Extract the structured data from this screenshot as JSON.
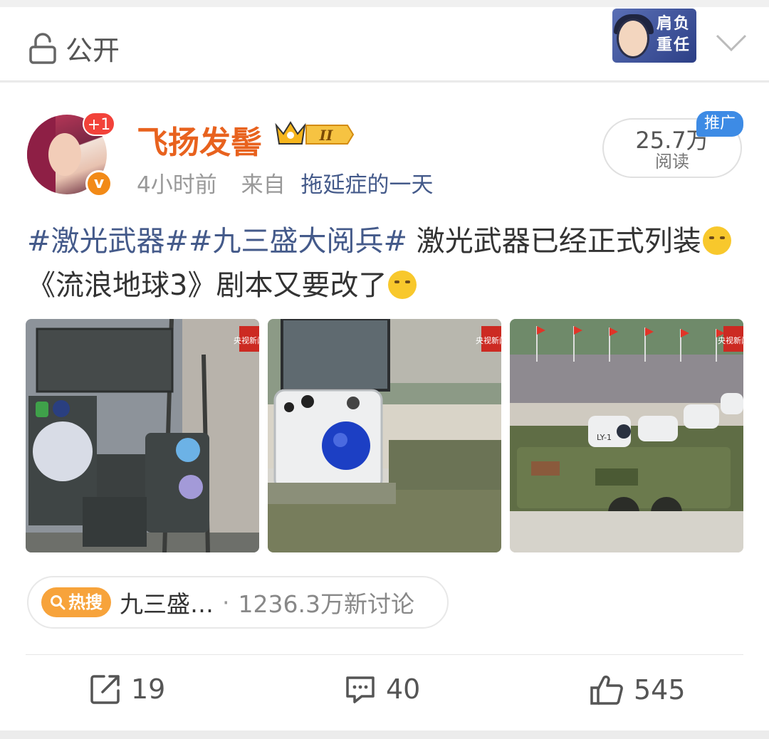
{
  "header": {
    "visibility_label": "公开",
    "sticker_text": "肩负重任"
  },
  "post": {
    "avatar_badge": "+1",
    "verified_mark": "v",
    "username": "飞扬发髻",
    "vip_level": "II",
    "time": "4小时前",
    "from_label": "来自",
    "source": "拖延症的一天",
    "reads_value": "25.7万",
    "reads_label": "阅读",
    "promo_label": "推广",
    "tag1": "#激光武器#",
    "tag2": "#九三盛大阅兵#",
    "text_part1": " 激光武器已经正式列装",
    "text_part2": "《流浪地球3》剧本又要改了",
    "photo_watermark": "央视新闻",
    "vehicle_label": "LY-1"
  },
  "hot": {
    "pill_label": "热搜",
    "topic": "九三盛…",
    "separator": "·",
    "count": "1236.3万新讨论"
  },
  "actions": {
    "repost_count": "19",
    "comment_count": "40",
    "like_count": "545"
  }
}
